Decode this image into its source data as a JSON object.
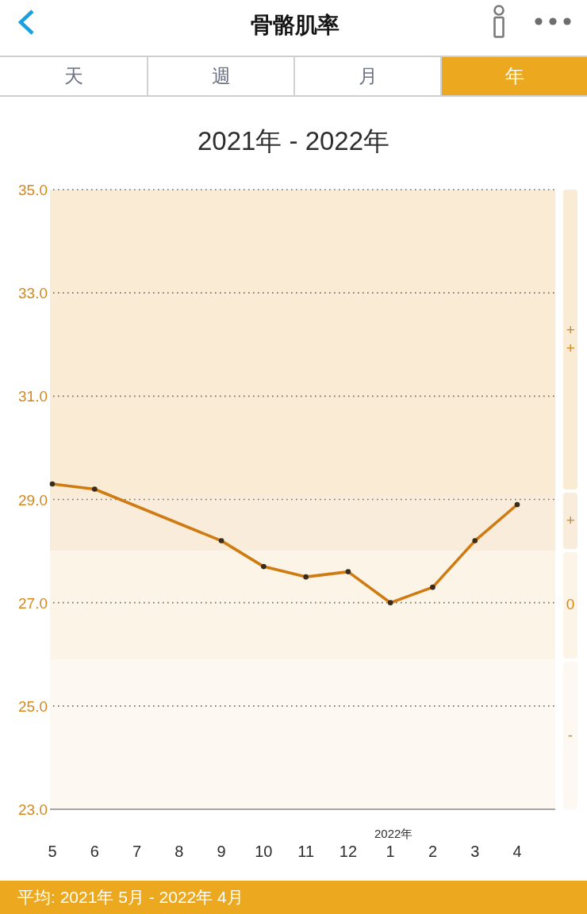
{
  "header": {
    "title": "骨骼肌率"
  },
  "tabs": [
    {
      "label": "天",
      "selected": false
    },
    {
      "label": "週",
      "selected": false
    },
    {
      "label": "月",
      "selected": false
    },
    {
      "label": "年",
      "selected": true
    }
  ],
  "chart": {
    "chart_data": {
      "type": "line",
      "title": "2021年 - 2022年",
      "categories": [
        "5",
        "6",
        "7",
        "8",
        "9",
        "10",
        "11",
        "12",
        "1",
        "2",
        "3",
        "4"
      ],
      "series": [
        {
          "color": "#d07b12",
          "marker": "o",
          "values": [
            29.3,
            29.2,
            null,
            null,
            28.2,
            27.7,
            27.5,
            27.6,
            27.0,
            27.3,
            28.2,
            28.9
          ]
        }
      ],
      "ylim": [
        23,
        35
      ],
      "yticks": [
        {
          "value": 35,
          "label": "35.0"
        },
        {
          "value": 33,
          "label": "33.0"
        },
        {
          "value": 31,
          "label": "31.0"
        },
        {
          "value": 29,
          "label": "29.0"
        },
        {
          "value": 27,
          "label": "27.0"
        },
        {
          "value": 25,
          "label": "25.0"
        },
        {
          "value": 23,
          "label": "23.0"
        }
      ],
      "grid": true,
      "bands": [
        {
          "axis": "y",
          "from": 29.1,
          "to": 35,
          "label": "++",
          "color": "#faebd5"
        },
        {
          "axis": "y",
          "from": 28,
          "to": 29.1,
          "label": "+",
          "color": "#f9ecdb"
        },
        {
          "axis": "y",
          "from": 25.9,
          "to": 28,
          "label": "0",
          "color": "#fcf4e7"
        },
        {
          "axis": "y",
          "from": 23,
          "to": 25.9,
          "label": "-",
          "color": "#fdf9f2"
        }
      ],
      "annotations": [
        "2022年"
      ]
    }
  },
  "footer": {
    "text": "平均: 2021年 5月 - 2022年 4月"
  }
}
